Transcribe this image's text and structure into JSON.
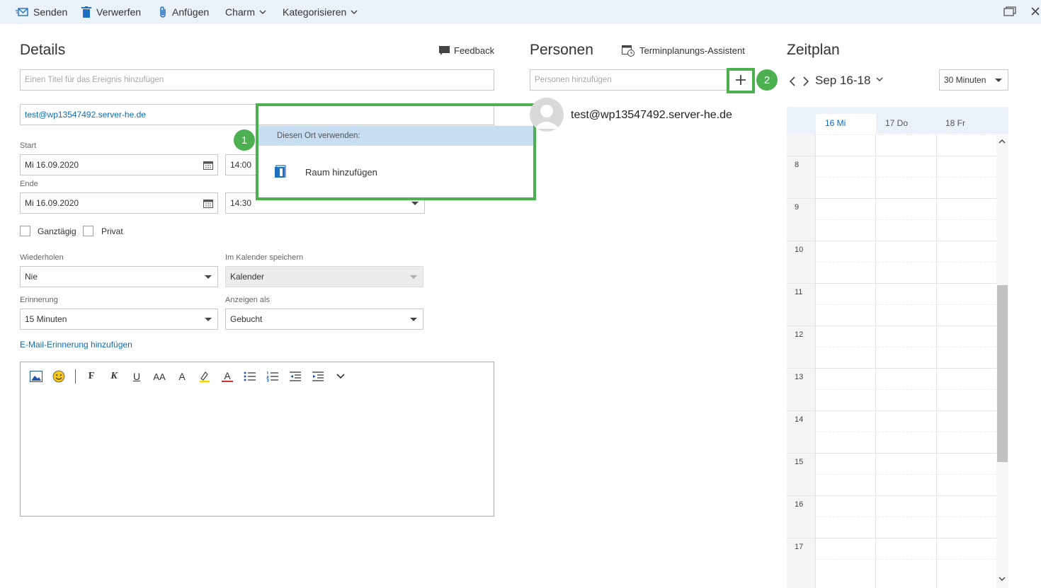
{
  "toolbar": {
    "send": "Senden",
    "discard": "Verwerfen",
    "attach": "Anfügen",
    "charm": "Charm",
    "categorize": "Kategorisieren"
  },
  "details": {
    "heading": "Details",
    "feedback": "Feedback",
    "title_placeholder": "Einen Titel für das Ereignis hinzufügen",
    "location_value": "test@wp13547492.server-he.de",
    "start_label": "Start",
    "start_date": "Mi 16.09.2020",
    "start_time": "14:00",
    "end_label": "Ende",
    "end_date": "Mi 16.09.2020",
    "end_time": "14:30",
    "all_day": "Ganztägig",
    "private": "Privat",
    "repeat_label": "Wiederholen",
    "repeat_value": "Nie",
    "save_in_label": "Im Kalender speichern",
    "save_in_value": "Kalender",
    "reminder_label": "Erinnerung",
    "reminder_value": "15 Minuten",
    "show_as_label": "Anzeigen als",
    "show_as_value": "Gebucht",
    "email_reminder": "E-Mail-Erinnerung hinzufügen"
  },
  "editor": {
    "bold": "F",
    "italic": "K",
    "underline": "U",
    "font_size": "AA",
    "grow": "A",
    "font_color": "A"
  },
  "dropdown": {
    "header": "Diesen Ort verwenden:",
    "add_room": "Raum hinzufügen"
  },
  "people": {
    "heading": "Personen",
    "assistant": "Terminplanungs-Assistent",
    "add_placeholder": "Personen hinzufügen",
    "attendee": "test@wp13547492.server-he.de"
  },
  "schedule": {
    "heading": "Zeitplan",
    "range": "Sep 16-18",
    "interval": "30 Minuten",
    "days": [
      "16 Mi",
      "17 Do",
      "18 Fr"
    ],
    "hours": [
      "8",
      "9",
      "10",
      "11",
      "12",
      "13",
      "14",
      "15",
      "16",
      "17"
    ]
  },
  "badges": {
    "one": "1",
    "two": "2"
  },
  "colors": {
    "accent": "#0b6bbd",
    "highlight": "#4caf50",
    "toolbar_bg": "#eaf1f9"
  }
}
